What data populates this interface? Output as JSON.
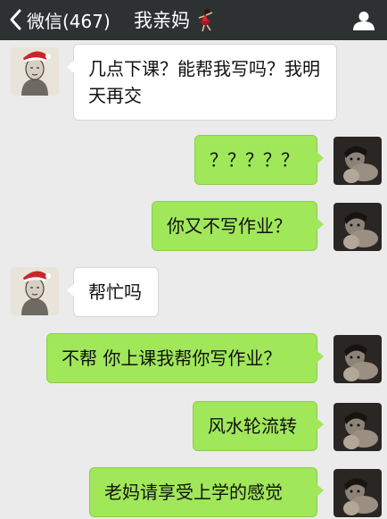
{
  "header": {
    "back_label": "微信(467)",
    "title": "我亲妈",
    "bar_color": "#2e3132",
    "title_emoji_icon": "dancer-emoji-icon",
    "profile_icon": "profile-person-icon"
  },
  "colors": {
    "chat_background": "#ebebeb",
    "sent_bubble": "#a0e75a",
    "received_bubble": "#ffffff"
  },
  "messages": [
    {
      "sender": "mom",
      "text": "几点下课？能帮我写吗？我明天再交"
    },
    {
      "sender": "me",
      "text": "？？？？？"
    },
    {
      "sender": "me",
      "text": "你又不写作业？"
    },
    {
      "sender": "mom",
      "text": "帮忙吗"
    },
    {
      "sender": "me",
      "text": "不帮 你上课我帮你写作业？"
    },
    {
      "sender": "me",
      "text": "风水轮流转"
    },
    {
      "sender": "me",
      "text": "老妈请享受上学的感觉"
    }
  ]
}
